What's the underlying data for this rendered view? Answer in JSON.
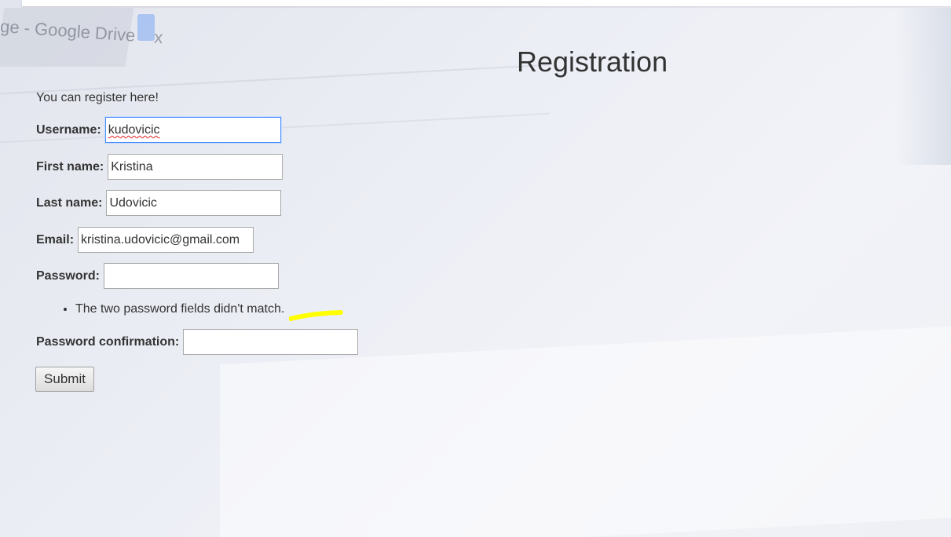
{
  "page": {
    "title": "Registration",
    "intro": "You can register here!"
  },
  "background_tab": {
    "label": "ge - Google Drive",
    "close": "x"
  },
  "form": {
    "username": {
      "label": "Username:",
      "value": "kudovicic"
    },
    "first_name": {
      "label": "First name:",
      "value": "Kristina"
    },
    "last_name": {
      "label": "Last name:",
      "value": "Udovicic"
    },
    "email": {
      "label": "Email:",
      "value": "kristina.udovicic@gmail.com"
    },
    "password": {
      "label": "Password:",
      "value": ""
    },
    "errors": [
      "The two password fields didn't match."
    ],
    "password_confirmation": {
      "label": "Password confirmation:",
      "value": ""
    },
    "submit_label": "Submit"
  },
  "colors": {
    "focus_border": "#4d90fe",
    "highlight_mark": "#ffff00",
    "spellcheck": "#e02020"
  }
}
